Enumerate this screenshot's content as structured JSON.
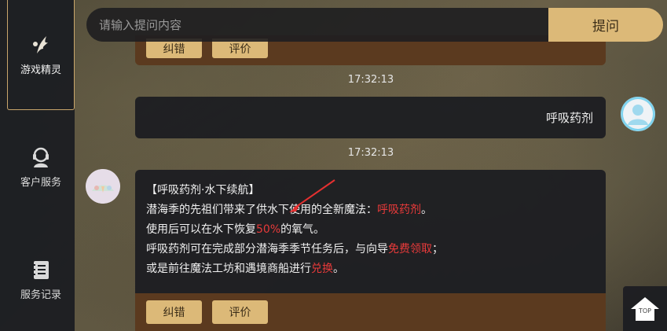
{
  "search": {
    "placeholder": "请输入提问内容",
    "submit_label": "提问"
  },
  "sidebar": {
    "items": [
      {
        "label": "游戏精灵",
        "icon": "sprite-wing-icon",
        "active": true
      },
      {
        "label": "客户服务",
        "icon": "customer-service-icon",
        "active": false
      },
      {
        "label": "服务记录",
        "icon": "service-record-icon",
        "active": false
      }
    ]
  },
  "chat": {
    "prev_actions": {
      "correct_label": "纠错",
      "rate_label": "评价"
    },
    "timestamp_1": "17:32:13",
    "user_message": "呼吸药剂",
    "timestamp_2": "17:32:13",
    "answer": {
      "title": "【呼吸药剂·水下续航】",
      "line1_prefix": "潜海季的先祖们带来了供水下使用的全新魔法：",
      "line1_highlight": "呼吸药剂",
      "line1_suffix": "。",
      "line2_prefix": "使用后可以在水下恢复",
      "line2_highlight": "50%",
      "line2_suffix": "的氧气。",
      "line3_prefix": "呼吸药剂可在完成部分潜海季季节任务后，与向导",
      "line3_highlight": "免费领取",
      "line3_suffix": "；",
      "line4_prefix": "或是前往魔法工坊和遇境商船进行",
      "line4_highlight": "兑换",
      "line4_suffix": "。"
    },
    "answer_actions": {
      "correct_label": "纠错",
      "rate_label": "评价"
    }
  },
  "top_button": {
    "label": "TOP"
  },
  "colors": {
    "accent": "#dcb978",
    "highlight": "#e83a3a",
    "panel": "#1c1e22",
    "bar": "#5b3a1f"
  }
}
